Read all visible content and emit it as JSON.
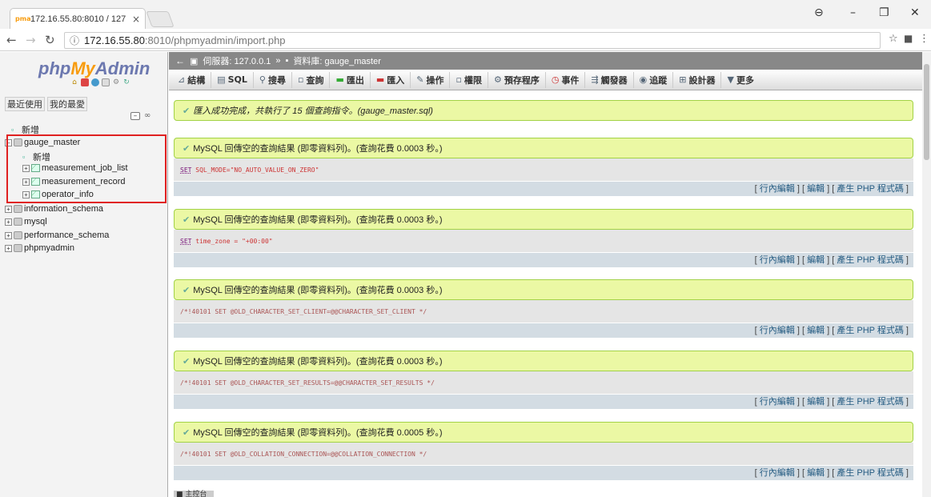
{
  "browser": {
    "tab_title": "172.16.55.80:8010 / 127",
    "url_host": "172.16.55.80",
    "url_path": ":8010/phpmyadmin/import.php"
  },
  "sidebar": {
    "logo_php": "php",
    "logo_my": "My",
    "logo_admin": "Admin",
    "tab_recent": "最近使用",
    "tab_fav": "我的最愛",
    "new_root": "新增",
    "db_gauge": "gauge_master",
    "new_in_db": "新增",
    "tables": [
      "measurement_job_list",
      "measurement_record",
      "operator_info"
    ],
    "other_dbs": [
      "information_schema",
      "mysql",
      "performance_schema",
      "phpmyadmin"
    ]
  },
  "main": {
    "breadcrumb_server": "伺服器: 127.0.0.1",
    "breadcrumb_db": "資料庫: gauge_master",
    "menu": [
      "結構",
      "SQL",
      "搜尋",
      "查詢",
      "匯出",
      "匯入",
      "操作",
      "權限",
      "預存程序",
      "事件",
      "觸發器",
      "追蹤",
      "設計器",
      "更多"
    ],
    "import_msg": "匯入成功完成，共執行了 15 個查詢指令。(gauge_master.sql)",
    "results": [
      {
        "msg": "MySQL 回傳空的查詢結果 (即零資料列)。(查詢花費 0.0003 秒。)",
        "sql_kw": "SET",
        "sql_rest": " SQL_MODE=\"NO_AUTO_VALUE_ON_ZERO\""
      },
      {
        "msg": "MySQL 回傳空的查詢結果 (即零資料列)。(查詢花費 0.0003 秒。)",
        "sql_kw": "SET",
        "sql_rest": " time_zone = \"+00:00\""
      },
      {
        "msg": "MySQL 回傳空的查詢結果 (即零資料列)。(查詢花費 0.0003 秒。)",
        "sql_kw": "",
        "sql_rest": "/*!40101 SET @OLD_CHARACTER_SET_CLIENT=@@CHARACTER_SET_CLIENT */"
      },
      {
        "msg": "MySQL 回傳空的查詢結果 (即零資料列)。(查詢花費 0.0003 秒。)",
        "sql_kw": "",
        "sql_rest": "/*!40101 SET @OLD_CHARACTER_SET_RESULTS=@@CHARACTER_SET_RESULTS */"
      },
      {
        "msg": "MySQL 回傳空的查詢結果 (即零資料列)。(查詢花費 0.0005 秒。)",
        "sql_kw": "",
        "sql_rest": "/*!40101 SET @OLD_COLLATION_CONNECTION=@@COLLATION_CONNECTION */"
      }
    ],
    "link_inline": "行內編輯",
    "link_edit": "編輯",
    "link_php": "產生 PHP 程式碼",
    "console": "主控台"
  },
  "colors": {
    "accent": "#6c78af",
    "orange": "#f89c0e",
    "success_bg": "#ebf8a4",
    "highlight": "#e02020"
  }
}
